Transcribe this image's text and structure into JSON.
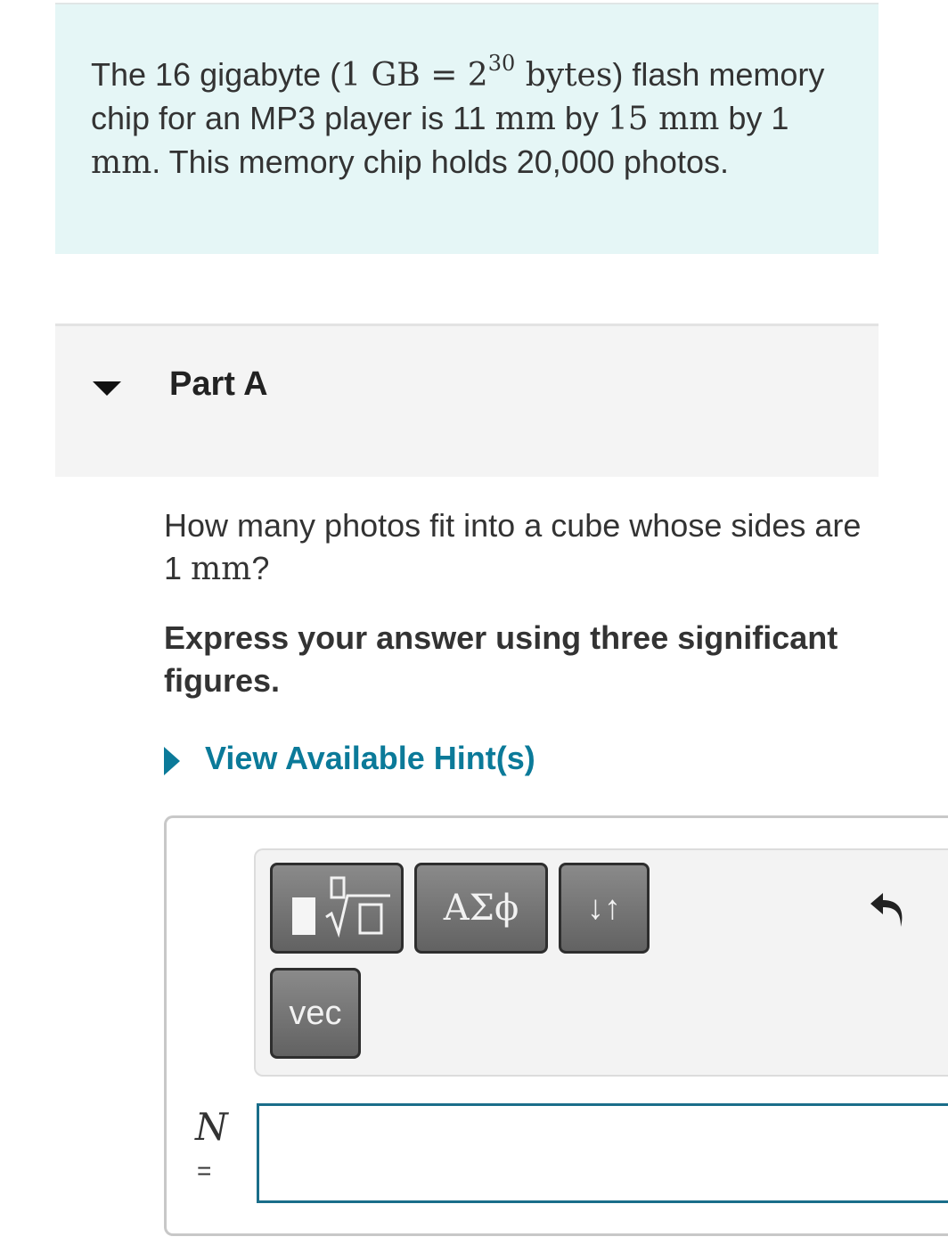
{
  "intro": {
    "t1": "The 16 gigabyte (",
    "m1": "1 GB = 2",
    "m1_exp": "30",
    "m1b": " bytes",
    "t2": ") flash memory chip for an MP3 player is 11 ",
    "m2": "mm",
    "t3": " by ",
    "m3": "15 mm",
    "t4": " by 1 ",
    "m4": "mm",
    "t5": ". This memory chip holds 20,000 photos."
  },
  "part": {
    "title": "Part A",
    "collapse_icon": "caret-down-icon"
  },
  "question": {
    "text_a": "How many photos fit into a cube whose sides are 1 ",
    "text_unit": "mm",
    "text_b": "?",
    "instruction": "Express your answer using three significant figures."
  },
  "hints": {
    "label": "View Available Hint(s)",
    "icon": "caret-right-icon",
    "accent": "#0b7a99"
  },
  "toolbar": {
    "templates_icon": "templates-sqrt-icon",
    "greek_label": "ΑΣϕ",
    "arrows_label": "↓↑",
    "vec_label": "vec",
    "undo_icon": "undo-icon"
  },
  "answer": {
    "variable": "N",
    "equals": "=",
    "value": "",
    "border_color": "#1a6e8a"
  }
}
